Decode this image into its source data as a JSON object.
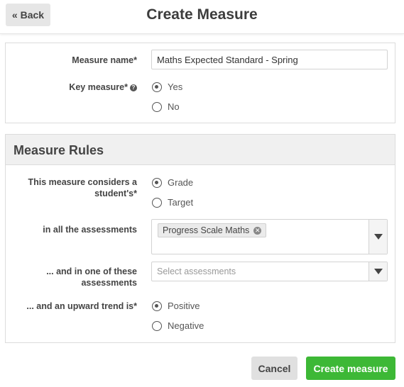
{
  "header": {
    "back_label": "« Back",
    "title": "Create Measure"
  },
  "details": {
    "measure_name_label": "Measure name*",
    "measure_name_value": "Maths Expected Standard - Spring",
    "key_measure_label": "Key measure*",
    "key_measure_help_icon": "?",
    "key_measure_options": [
      {
        "label": "Yes",
        "checked": true
      },
      {
        "label": "No",
        "checked": false
      }
    ]
  },
  "rules": {
    "heading": "Measure Rules",
    "considers_label_line1": "This measure considers a",
    "considers_label_line2": "student's*",
    "considers_options": [
      {
        "label": "Grade",
        "checked": true
      },
      {
        "label": "Target",
        "checked": false
      }
    ],
    "all_assessments_label": "in all the assessments",
    "all_assessments_selected": [
      "Progress Scale Maths"
    ],
    "one_of_label_line1": "... and in one of these",
    "one_of_label_line2": "assessments",
    "one_of_placeholder": "Select assessments",
    "trend_label": "... and an upward trend is*",
    "trend_options": [
      {
        "label": "Positive",
        "checked": true
      },
      {
        "label": "Negative",
        "checked": false
      }
    ]
  },
  "actions": {
    "cancel_label": "Cancel",
    "create_label": "Create measure"
  },
  "colors": {
    "create_button": "#3db836",
    "panel_header_bg": "#f0f0f0"
  }
}
